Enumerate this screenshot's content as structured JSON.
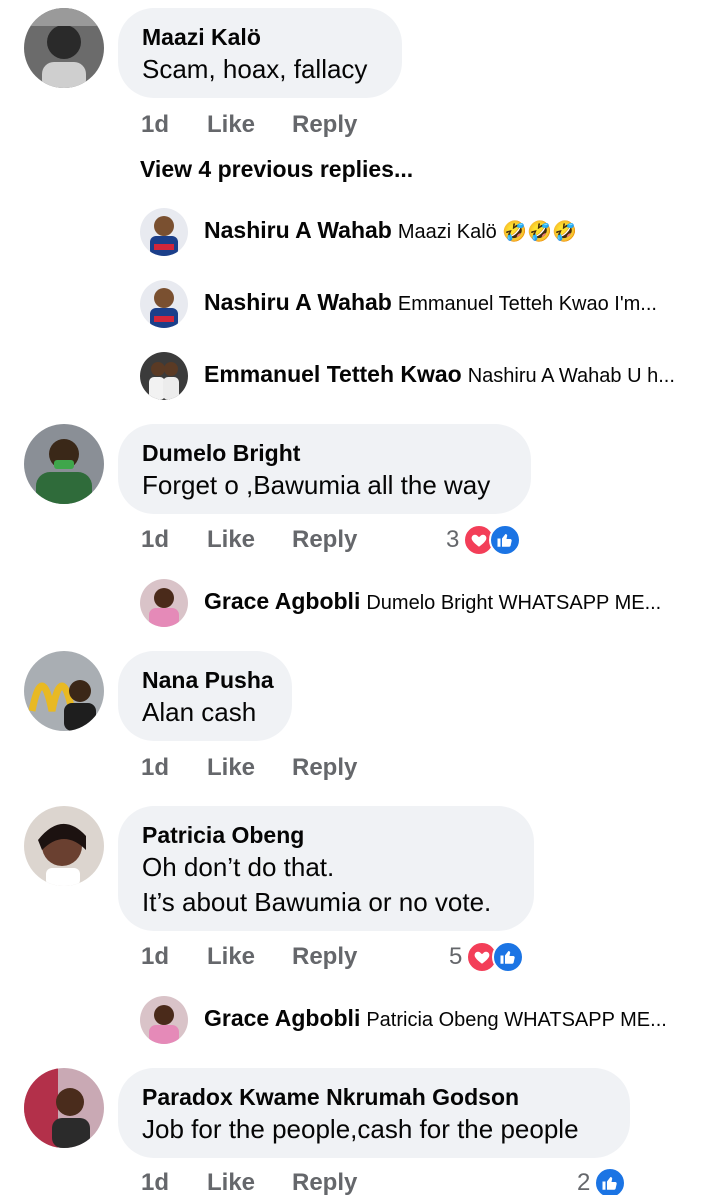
{
  "comments": [
    {
      "name": "Maazi Kalö",
      "lines": [
        "Scam, hoax, fallacy"
      ],
      "time": "1d",
      "like": "Like",
      "reply": "Reply",
      "view_more": "View 4 previous replies...",
      "replies": [
        {
          "name": "Nashiru A Wahab",
          "text": "Maazi Kalö 🤣🤣🤣"
        },
        {
          "name": "Nashiru A Wahab",
          "text": "Emmanuel Tetteh Kwao I'm..."
        },
        {
          "name": "Emmanuel Tetteh Kwao",
          "text": "Nashiru A Wahab U h..."
        }
      ]
    },
    {
      "name": "Dumelo Bright",
      "lines": [
        "Forget o ,Bawumia all the way"
      ],
      "time": "1d",
      "like": "Like",
      "reply": "Reply",
      "reaction_count": "3",
      "replies": [
        {
          "name": "Grace Agbobli",
          "text": "Dumelo Bright WHATSAPP ME..."
        }
      ]
    },
    {
      "name": "Nana Pusha",
      "lines": [
        "Alan cash"
      ],
      "time": "1d",
      "like": "Like",
      "reply": "Reply"
    },
    {
      "name": "Patricia Obeng",
      "lines": [
        "Oh don’t do that.",
        "It’s about Bawumia or no vote."
      ],
      "time": "1d",
      "like": "Like",
      "reply": "Reply",
      "reaction_count": "5",
      "replies": [
        {
          "name": "Grace Agbobli",
          "text": "Patricia Obeng WHATSAPP ME..."
        }
      ]
    },
    {
      "name": "Paradox Kwame Nkrumah Godson",
      "lines": [
        "Job for the people,cash for the people"
      ],
      "time": "1d",
      "like": "Like",
      "reply": "Reply",
      "reaction_count": "2"
    }
  ],
  "colors": {
    "bubble": "#f0f2f5",
    "meta_text": "#65676b",
    "love": "#f33e58",
    "like": "#1b74e4"
  },
  "icons": [
    "love-reaction-icon",
    "like-reaction-icon",
    "avatar-photo"
  ]
}
